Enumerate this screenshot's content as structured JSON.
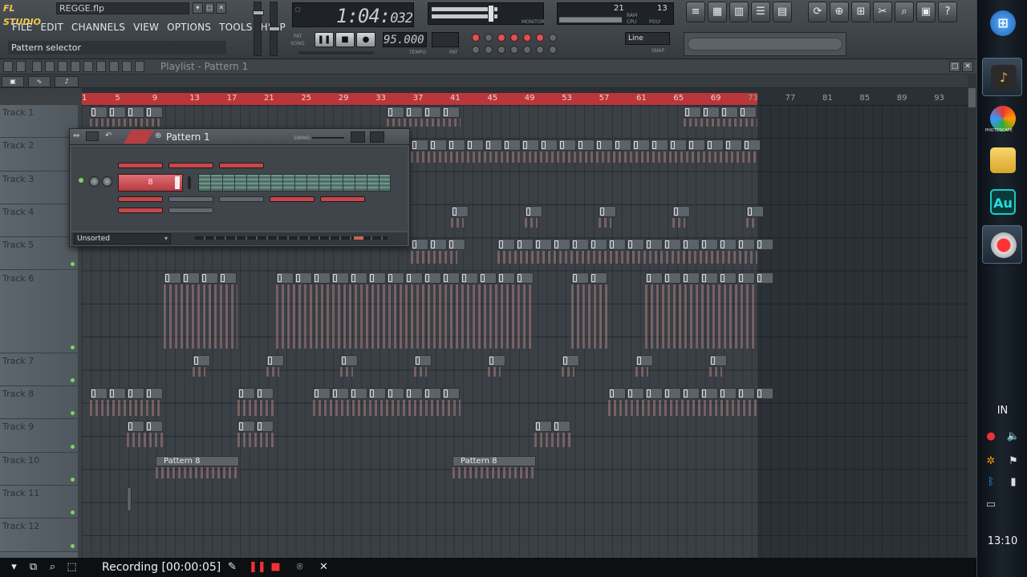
{
  "app": {
    "logo": "FL STUDIO",
    "project_file": "REGGE.flp",
    "window_buttons": [
      "▾",
      "□",
      "✕"
    ]
  },
  "menu": [
    "FILE",
    "EDIT",
    "CHANNELS",
    "VIEW",
    "OPTIONS",
    "TOOLS",
    "HELP"
  ],
  "hint_bar": "Pattern selector",
  "display": {
    "time_main": "1:04:",
    "time_ticks": "032",
    "tempo": "95.000",
    "tempo_label": "TEMPO",
    "pat_label": "PAT",
    "song_label": "SONG",
    "monitor_label": "MONITOR",
    "cpu": "21",
    "poly": "13",
    "ram_label": "RAM",
    "cpu_label": "CPU",
    "poly_label": "POLY",
    "snap_label": "SNAP",
    "mode": "Line"
  },
  "transport": [
    "❚❚",
    "■",
    "●"
  ],
  "top_tools_left": [
    "≡",
    "▦",
    "▥",
    "☰",
    "▤"
  ],
  "top_tools_right": [
    "⟳",
    "⊕",
    "⊞",
    "✂",
    "⌕",
    "▣",
    "?"
  ],
  "playlist": {
    "title": "Playlist - Pattern 1",
    "ruler_marks": [
      "1",
      "5",
      "9",
      "13",
      "17",
      "21",
      "25",
      "29",
      "33",
      "37",
      "41",
      "45",
      "49",
      "53",
      "57",
      "61",
      "65",
      "69",
      "73",
      "77",
      "81",
      "85",
      "89",
      "93"
    ],
    "tracks": [
      "Track 1",
      "Track 2",
      "Track 3",
      "Track 4",
      "Track 5",
      "Track 6",
      "Track 7",
      "Track 8",
      "Track 9",
      "Track 10",
      "Track 11",
      "Track 12"
    ],
    "pattern_clips": [
      {
        "label": "Pattern 8"
      },
      {
        "label": "Pattern 8"
      }
    ]
  },
  "channel_rack": {
    "title": "Pattern 1",
    "swing_label": "SWING",
    "channel_name": "8",
    "filter": "Unsorted"
  },
  "recorder": {
    "status": "Recording [00:00:05]"
  },
  "taskbar": {
    "apps": [
      "windows-start",
      "fl-studio",
      "photoscape",
      "file-explorer",
      "adobe-audition",
      "recorder"
    ],
    "photoscape_label": "PHOTOSCAPE",
    "audition_label": "Au",
    "lang": "IN",
    "clock": "13:10"
  },
  "colors": {
    "accent_red": "#b9363b",
    "pad_red": "#c4484d",
    "led_green": "#7dd35c",
    "track_header": "#566066"
  }
}
